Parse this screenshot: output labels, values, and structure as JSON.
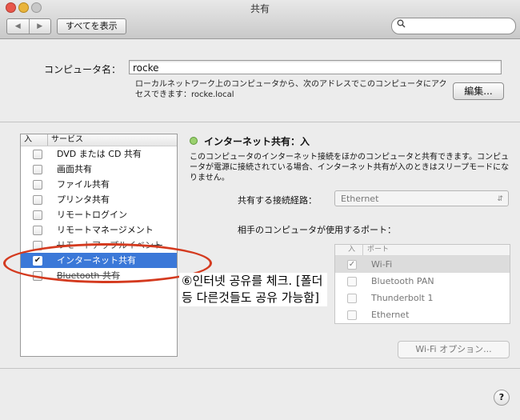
{
  "window": {
    "title": "共有"
  },
  "toolbar": {
    "back_symbol": "◀",
    "forward_symbol": "▶",
    "show_all_label": "すべてを表示",
    "search_placeholder": "",
    "search_icon": "search-icon"
  },
  "computer_name": {
    "label": "コンピュータ名：",
    "value": "rocke",
    "description": "ローカルネットワーク上のコンピュータから、次のアドレスでこのコンピュータにアクセスできます：rocke.local",
    "edit_button": "編集..."
  },
  "services": {
    "col_on": "入",
    "col_service": "サービス",
    "items": [
      {
        "label": "DVD または CD 共有",
        "checked": false
      },
      {
        "label": "画面共有",
        "checked": false
      },
      {
        "label": "ファイル共有",
        "checked": false
      },
      {
        "label": "プリンタ共有",
        "checked": false
      },
      {
        "label": "リモートログイン",
        "checked": false
      },
      {
        "label": "リモートマネージメント",
        "checked": false
      },
      {
        "label": "リモートアップルイベント",
        "checked": false
      },
      {
        "label": "インターネット共有",
        "checked": true,
        "selected": true
      },
      {
        "label": "Bluetooth 共有",
        "checked": false
      }
    ]
  },
  "detail": {
    "status": "インターネット共有：入",
    "status_color": "#9ad06e",
    "description": "このコンピュータのインターネット接続をほかのコンピュータと共有できます。コンピュータが電源に接続されている場合、インターネット共有が入のときはスリープモードになりません。",
    "share_from_label": "共有する接続経路：",
    "share_from_value": "Ethernet",
    "ports_label": "相手のコンピュータが使用するポート：",
    "ports_col_on": "入",
    "ports_col_port": "ポート",
    "ports": [
      {
        "label": "Wi-Fi",
        "checked": true
      },
      {
        "label": "Bluetooth PAN",
        "checked": false
      },
      {
        "label": "Thunderbolt 1",
        "checked": false
      },
      {
        "label": "Ethernet",
        "checked": false
      }
    ],
    "wifi_options_button": "Wi-Fi オプション..."
  },
  "help": {
    "label": "?"
  },
  "annotation": {
    "text": "⑥인터넷 공유를 체크. [폴더 등 다른것들도 공유 가능함]",
    "color": "#d43a1f"
  }
}
